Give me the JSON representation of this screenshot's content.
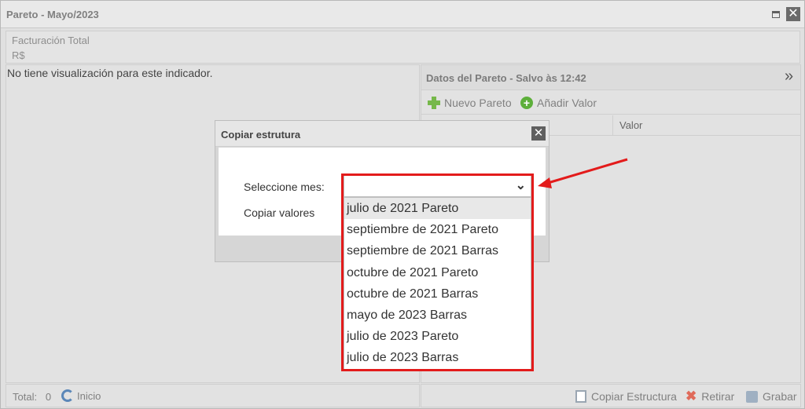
{
  "window": {
    "title": "Pareto - Mayo/2023"
  },
  "indicator": {
    "name": "Facturación Total",
    "unit": "R$"
  },
  "left_panel": {
    "message": "No tiene visualización para este indicador."
  },
  "right_panel": {
    "title": "Datos del Pareto - Salvo às 12:42",
    "toolbar": {
      "new_pareto": "Nuevo Pareto",
      "add_value": "Añadir Valor"
    },
    "columns": {
      "value": "Valor"
    }
  },
  "footer_left": {
    "total_label": "Total:",
    "total_value": "0",
    "home": "Inicio"
  },
  "footer_right": {
    "copy_structure": "Copiar Estructura",
    "withdraw": "Retirar",
    "save": "Grabar"
  },
  "dialog": {
    "title": "Copiar estrutura",
    "select_month_label": "Seleccione mes:",
    "copy_values_label": "Copiar valores",
    "select_value": "",
    "options": [
      "julio de 2021 Pareto",
      "septiembre de 2021 Pareto",
      "septiembre de 2021 Barras",
      "octubre de 2021 Pareto",
      "octubre de 2021 Barras",
      "mayo de 2023 Barras",
      "julio de 2023 Pareto",
      "julio de 2023 Barras"
    ]
  },
  "colors": {
    "highlight_frame": "#e31b1b",
    "accent_green": "#76b84a"
  }
}
